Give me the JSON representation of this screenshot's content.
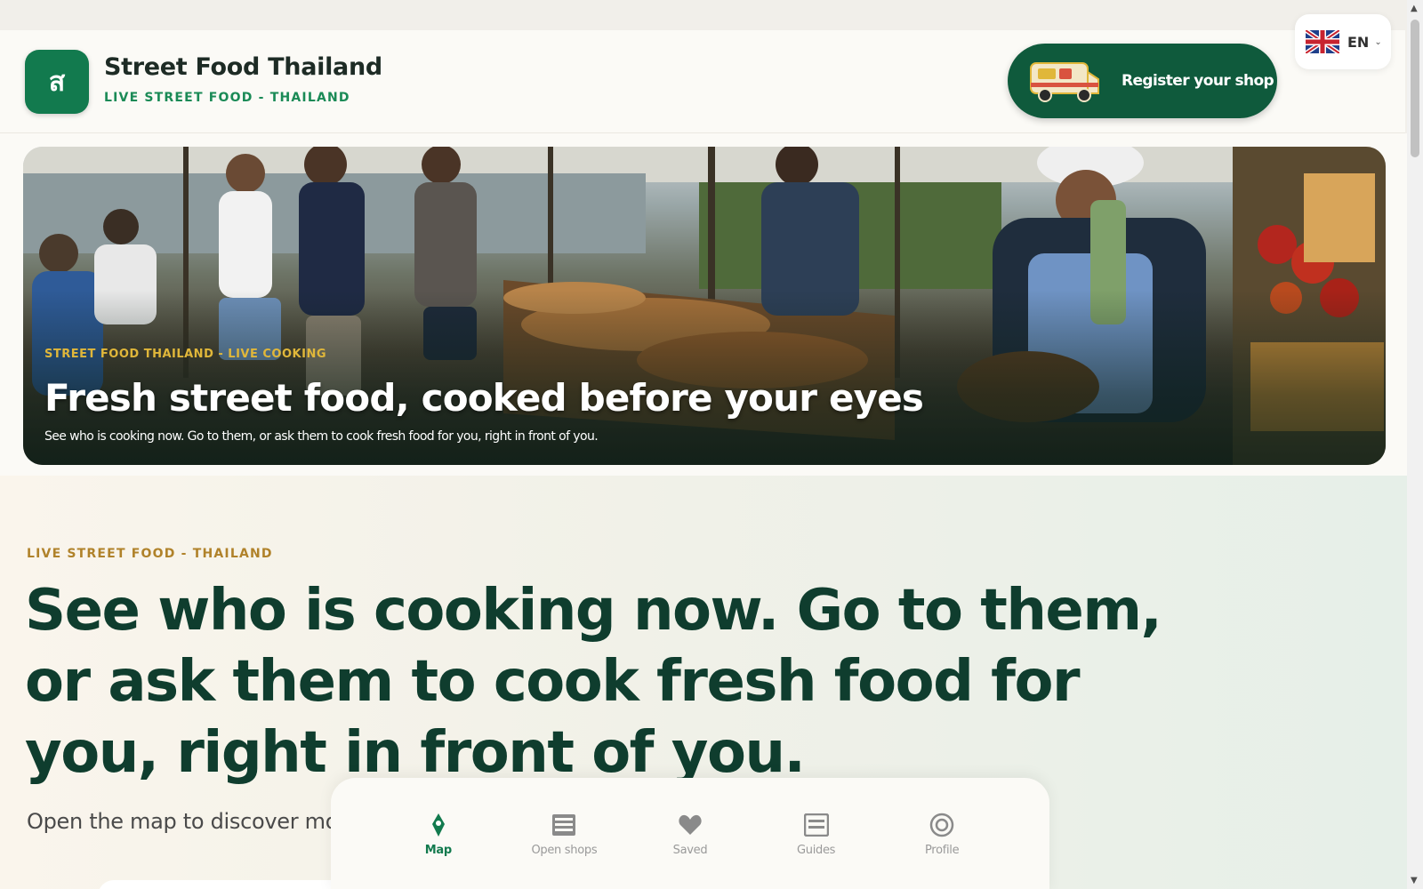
{
  "header": {
    "logo_glyph": "ส",
    "brand_name": "Street Food Thailand",
    "brand_tagline": "LIVE STREET FOOD - THAILAND",
    "register_label": "Register your shop"
  },
  "language": {
    "code": "EN",
    "flag": "uk-flag-icon"
  },
  "hero": {
    "kicker": "STREET FOOD THAILAND - LIVE COOKING",
    "title": "Fresh street food, cooked before your eyes",
    "description": "See who is cooking now. Go to them, or ask them to cook fresh food for you, right in front of you."
  },
  "intro": {
    "kicker": "LIVE STREET FOOD - THAILAND",
    "headline": "See who is cooking now. Go to them, or ask them to cook fresh food for you, right in front of you.",
    "subtext": "Open the map to discover mo"
  },
  "nav": {
    "items": [
      {
        "label": "Map",
        "icon": "map-pin-icon",
        "active": true
      },
      {
        "label": "Open shops",
        "icon": "shop-list-icon",
        "active": false
      },
      {
        "label": "Saved",
        "icon": "heart-icon",
        "active": false
      },
      {
        "label": "Guides",
        "icon": "guide-icon",
        "active": false
      },
      {
        "label": "Profile",
        "icon": "profile-icon",
        "active": false
      }
    ]
  },
  "colors": {
    "brand_green": "#127a4e",
    "dark_green": "#0f5a3c",
    "headline": "#0f3d2e",
    "accent_gold": "#e0b73a"
  }
}
